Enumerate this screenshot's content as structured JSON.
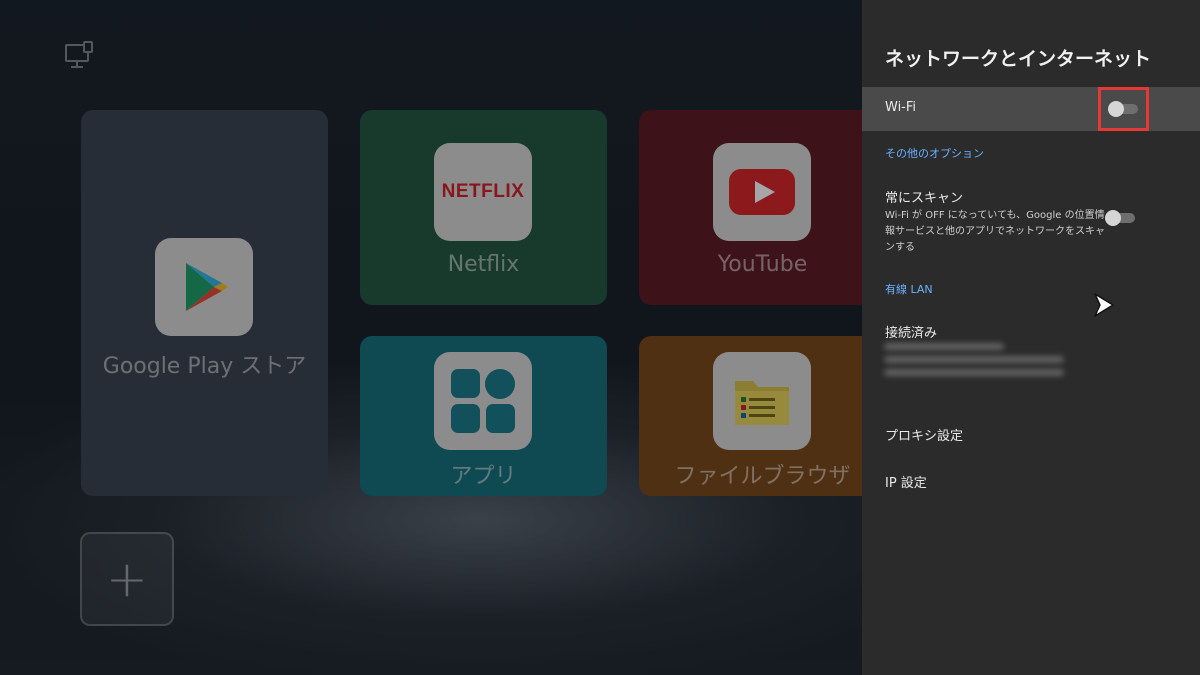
{
  "launcher": {
    "tiles": [
      {
        "label": "Google Play ストア"
      },
      {
        "label": "Netflix",
        "icon_text": "NETFLIX"
      },
      {
        "label": "YouTube"
      },
      {
        "label": "アプリ"
      },
      {
        "label": "ファイルブラウザ"
      }
    ],
    "add_label": "+"
  },
  "panel": {
    "title": "ネットワークとインターネット",
    "wifi": {
      "label": "Wi-Fi",
      "enabled": false
    },
    "more_options_link": "その他のオプション",
    "always_scan": {
      "title": "常にスキャン",
      "description": "Wi-Fi が OFF になっていても、Google の位置情報サービスと他のアプリでネットワークをスキャンする",
      "enabled": false
    },
    "wired_lan_header": "有線 LAN",
    "connected_label": "接続済み",
    "proxy_label": "プロキシ設定",
    "ip_label": "IP 設定"
  },
  "colors": {
    "panel_bg": "#2b2b2b",
    "selected_row": "#4a4a4a",
    "link_blue": "#6ab1ff",
    "highlight_red": "#e53935"
  }
}
